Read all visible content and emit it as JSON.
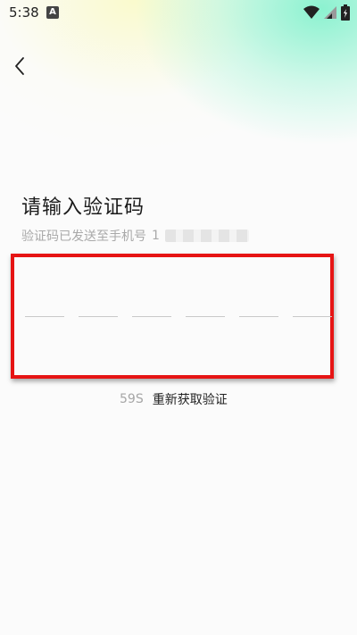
{
  "status_bar": {
    "time": "5:38",
    "notification_badge": "A",
    "icons": [
      "wifi-icon",
      "signal-icon",
      "battery-icon"
    ]
  },
  "header": {
    "back_icon": "chevron-left-icon"
  },
  "verify": {
    "title": "请输入验证码",
    "subtitle": "验证码已发送至手机号",
    "phone_masked": "1",
    "code_length": 6,
    "countdown": "59S",
    "resend_label": "重新获取验证"
  },
  "colors": {
    "highlight_border": "#e61414",
    "muted_text": "#a9a9a9",
    "accent_gradient": "#78f0c8"
  }
}
